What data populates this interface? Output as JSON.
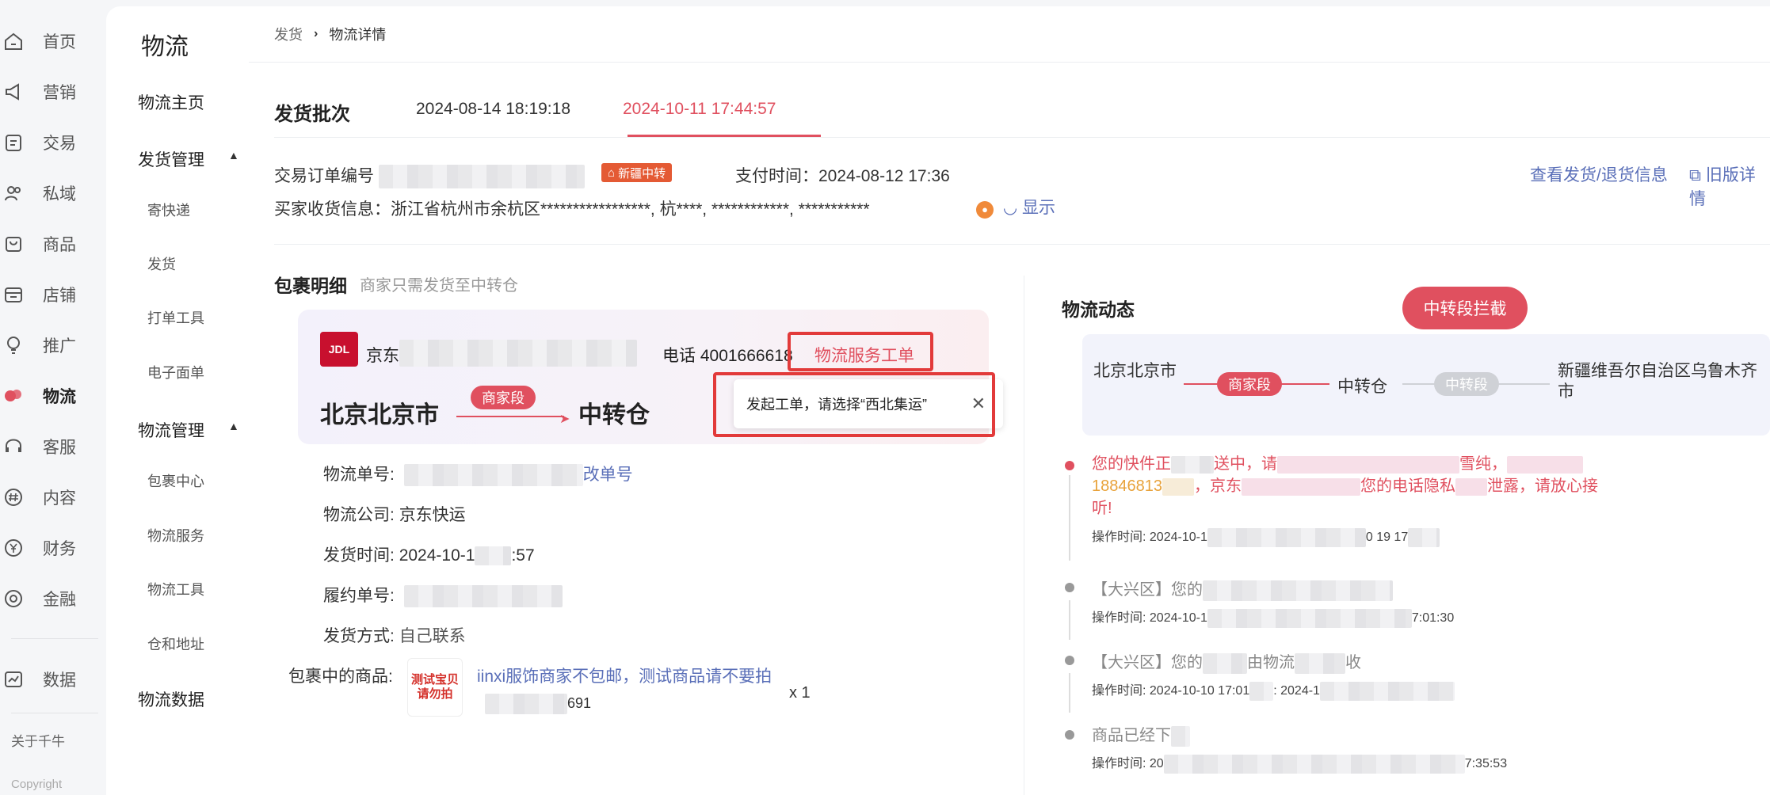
{
  "rail": {
    "items": [
      {
        "label": "首页"
      },
      {
        "label": "营销"
      },
      {
        "label": "交易"
      },
      {
        "label": "私域"
      },
      {
        "label": "商品"
      },
      {
        "label": "店铺"
      },
      {
        "label": "推广"
      },
      {
        "label": "物流"
      },
      {
        "label": "客服"
      },
      {
        "label": "内容"
      },
      {
        "label": "财务"
      },
      {
        "label": "金融"
      },
      {
        "label": "数据"
      }
    ],
    "about": "关于千牛",
    "copyright": "Copyright"
  },
  "sidebar": {
    "title": "物流",
    "home": "物流主页",
    "group1": "发货管理",
    "group1_items": [
      "寄快递",
      "发货",
      "打单工具",
      "电子面单"
    ],
    "group2": "物流管理",
    "group2_items": [
      "包裹中心",
      "物流服务",
      "物流工具",
      "仓和地址"
    ],
    "data": "物流数据"
  },
  "breadcrumb": {
    "parent": "发货",
    "current": "物流详情"
  },
  "batch": {
    "title": "发货批次",
    "tabs": [
      "2024-08-14 18:19:18",
      "2024-10-11 17:44:57"
    ],
    "active_tab": 1
  },
  "order": {
    "order_no_label": "交易订单编号",
    "badge": "新疆中转",
    "pay_time_label": "支付时间：",
    "pay_time": "2024-08-12 17:36",
    "view_shipping": "查看发货/退货信息",
    "old_detail": "旧版详情",
    "buyer_label": "买家收货信息：",
    "buyer_address": "浙江省杭州市余杭区*****************, 杭****, ************, ***********",
    "show": "显示"
  },
  "parcel": {
    "title": "包裹明细",
    "subtitle": "商家只需发货至中转仓",
    "carrier_prefix": "京东",
    "phone": "电话 4001666618",
    "service_ticket": "物流服务工单",
    "from": "北京北京市",
    "segment": "商家段",
    "to": "中转仓",
    "tooltip": "发起工单，请选择“西北集运”",
    "fields": {
      "waybill_label": "物流单号:",
      "waybill_link": "改单号",
      "company_label": "物流公司:",
      "company": "京东快运",
      "ship_time_label": "发货时间:",
      "ship_time_prefix": "2024-10-1",
      "ship_time_suffix": ":57",
      "fulfil_label": "履约单号:",
      "method_label": "发货方式:",
      "method": "自己联系",
      "goods_label": "包裹中的商品:",
      "goods_name": "iinxi服饰商家不包邮，测试商品请不要拍",
      "goods_sku_suffix": "691",
      "goods_qty": "x 1",
      "thumb_text": "测试宝贝请勿拍"
    }
  },
  "logistics": {
    "title": "物流动态",
    "intercept": "中转段拦截",
    "route": {
      "from": "北京北京市",
      "seg1": "商家段",
      "mid": "中转仓",
      "seg2": "中转段",
      "to": "新疆维吾尔自治区乌鲁木齐市"
    },
    "timeline": [
      {
        "line1": "您的快件正",
        "line1b": "送中，请",
        "line1c": "雪纯，",
        "phone": "18846813",
        "line2a": "，京东",
        "line2b": "您的电话隐私",
        "line2c": "泄露，请放心接",
        "line3": "听!",
        "time": "操作时间: 2024-10-1",
        "time2": "0 19 17"
      },
      {
        "text": "【大兴区】您的",
        "time": "操作时间: 2024-10-1",
        "time2": "7:01:30"
      },
      {
        "text": "【大兴区】您的",
        "text2": "由物流",
        "text3": "收",
        "time": "操作时间: 2024-10-10 17:01",
        "time2": ": 2024-1"
      },
      {
        "text": "商品已经下",
        "time": "操作时间: 20",
        "time2": "7:35:53"
      }
    ]
  },
  "colors": {
    "accent": "#e0505f",
    "link": "#5a6fb8",
    "highlight_box": "#e23a3a"
  }
}
